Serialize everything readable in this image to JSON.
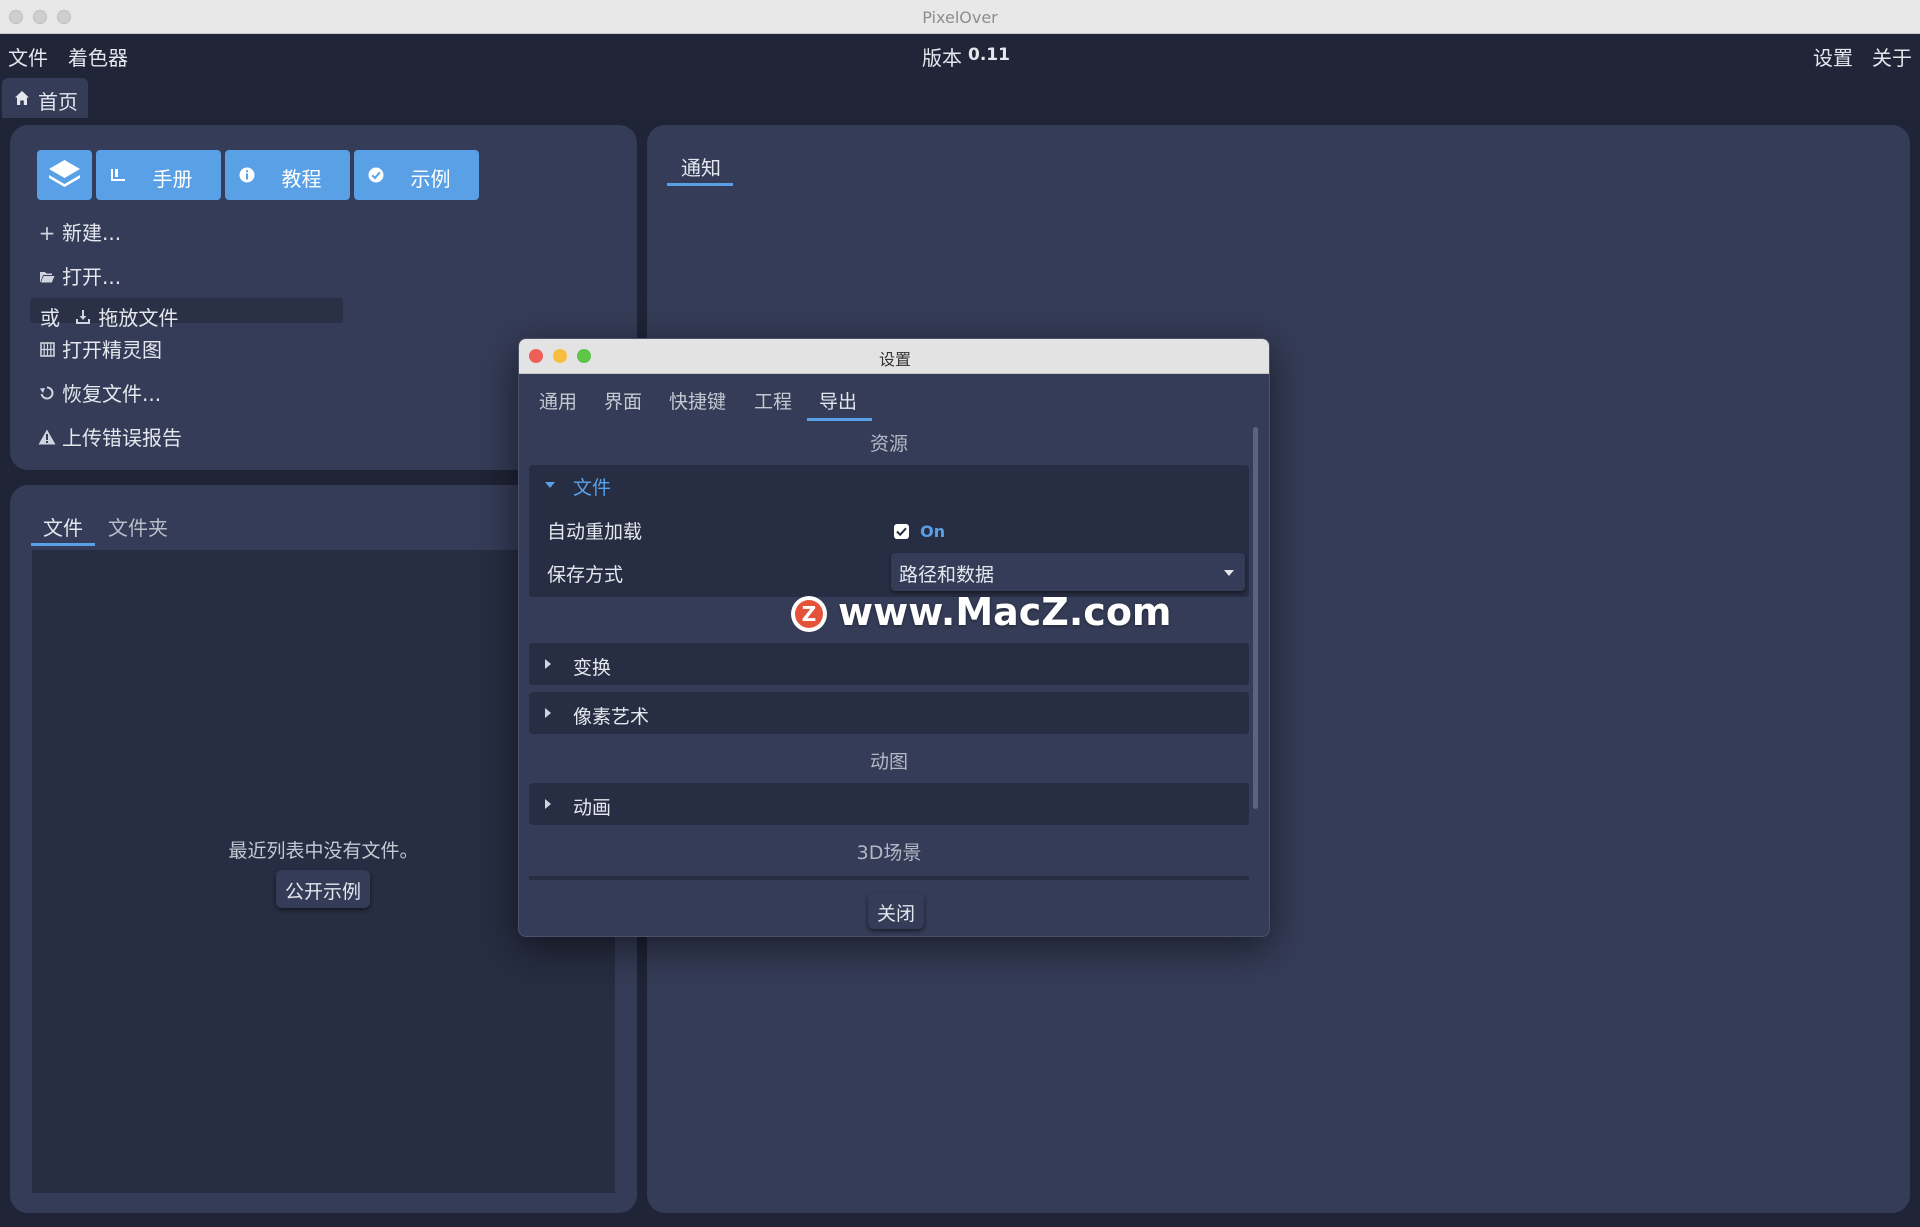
{
  "window": {
    "title": "PixelOver"
  },
  "menubar": {
    "file": "文件",
    "shader": "着色器",
    "version_label": "版本",
    "version_number": "0.11",
    "settings": "设置",
    "about": "关于"
  },
  "tabs": {
    "home": "首页"
  },
  "start_panel": {
    "buttons": {
      "manual": "手册",
      "tutorial": "教程",
      "examples": "示例"
    },
    "items": {
      "new": "新建...",
      "open": "打开...",
      "or_label": "或",
      "drop_files": "拖放文件",
      "open_sprite": "打开精灵图",
      "recover": "恢复文件...",
      "upload_error": "上传错误报告"
    }
  },
  "recent_panel": {
    "tab_files": "文件",
    "tab_folders": "文件夹",
    "empty_text": "最近列表中没有文件。",
    "open_examples_button": "公开示例"
  },
  "notifications_panel": {
    "tab": "通知"
  },
  "dialog": {
    "title": "设置",
    "tabs": [
      "通用",
      "界面",
      "快捷键",
      "工程",
      "导出"
    ],
    "active_tab": "导出",
    "section_resources": "资源",
    "group_file": {
      "title": "文件",
      "auto_reload_label": "自动重加载",
      "auto_reload_value": "On",
      "save_mode_label": "保存方式",
      "save_mode_value": "路径和数据"
    },
    "group_transform": "变换",
    "group_pixel_art": "像素艺术",
    "section_animation": "动图",
    "group_animation": "动画",
    "section_3d": "3D场景",
    "close_button": "关闭"
  },
  "watermark": {
    "text": "www.MacZ.com",
    "logo_letter": "Z"
  },
  "colors": {
    "accent": "#5aa0e7",
    "panel": "#353c57",
    "background": "#1f2436",
    "subpanel": "#272d42"
  }
}
